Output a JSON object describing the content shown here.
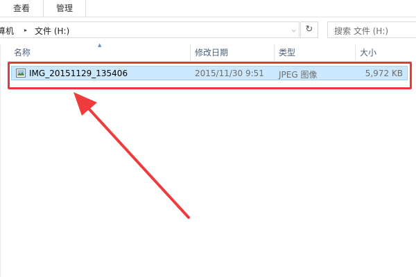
{
  "ribbon": {
    "tabs": [
      {
        "label": "查看"
      },
      {
        "label": "管理"
      }
    ]
  },
  "address": {
    "crumbs": [
      "算机",
      "文件 (H:)"
    ],
    "separator": "▸"
  },
  "search": {
    "placeholder": "搜索 文件 (H:)"
  },
  "columns": {
    "name": "名称",
    "date": "修改日期",
    "type": "类型",
    "size": "大小"
  },
  "files": [
    {
      "name": "IMG_20151129_135406",
      "date": "2015/11/30 9:51",
      "type": "JPEG 图像",
      "size": "5,972 KB",
      "selected": true,
      "icon": "image-file-icon"
    }
  ],
  "annotation": {
    "color": "#e8393a",
    "shape": "arrow-and-highlight-box"
  },
  "colors": {
    "selection_fill": "#cce8ff",
    "selection_border": "#99d1ff",
    "header_text": "#4c607a"
  }
}
